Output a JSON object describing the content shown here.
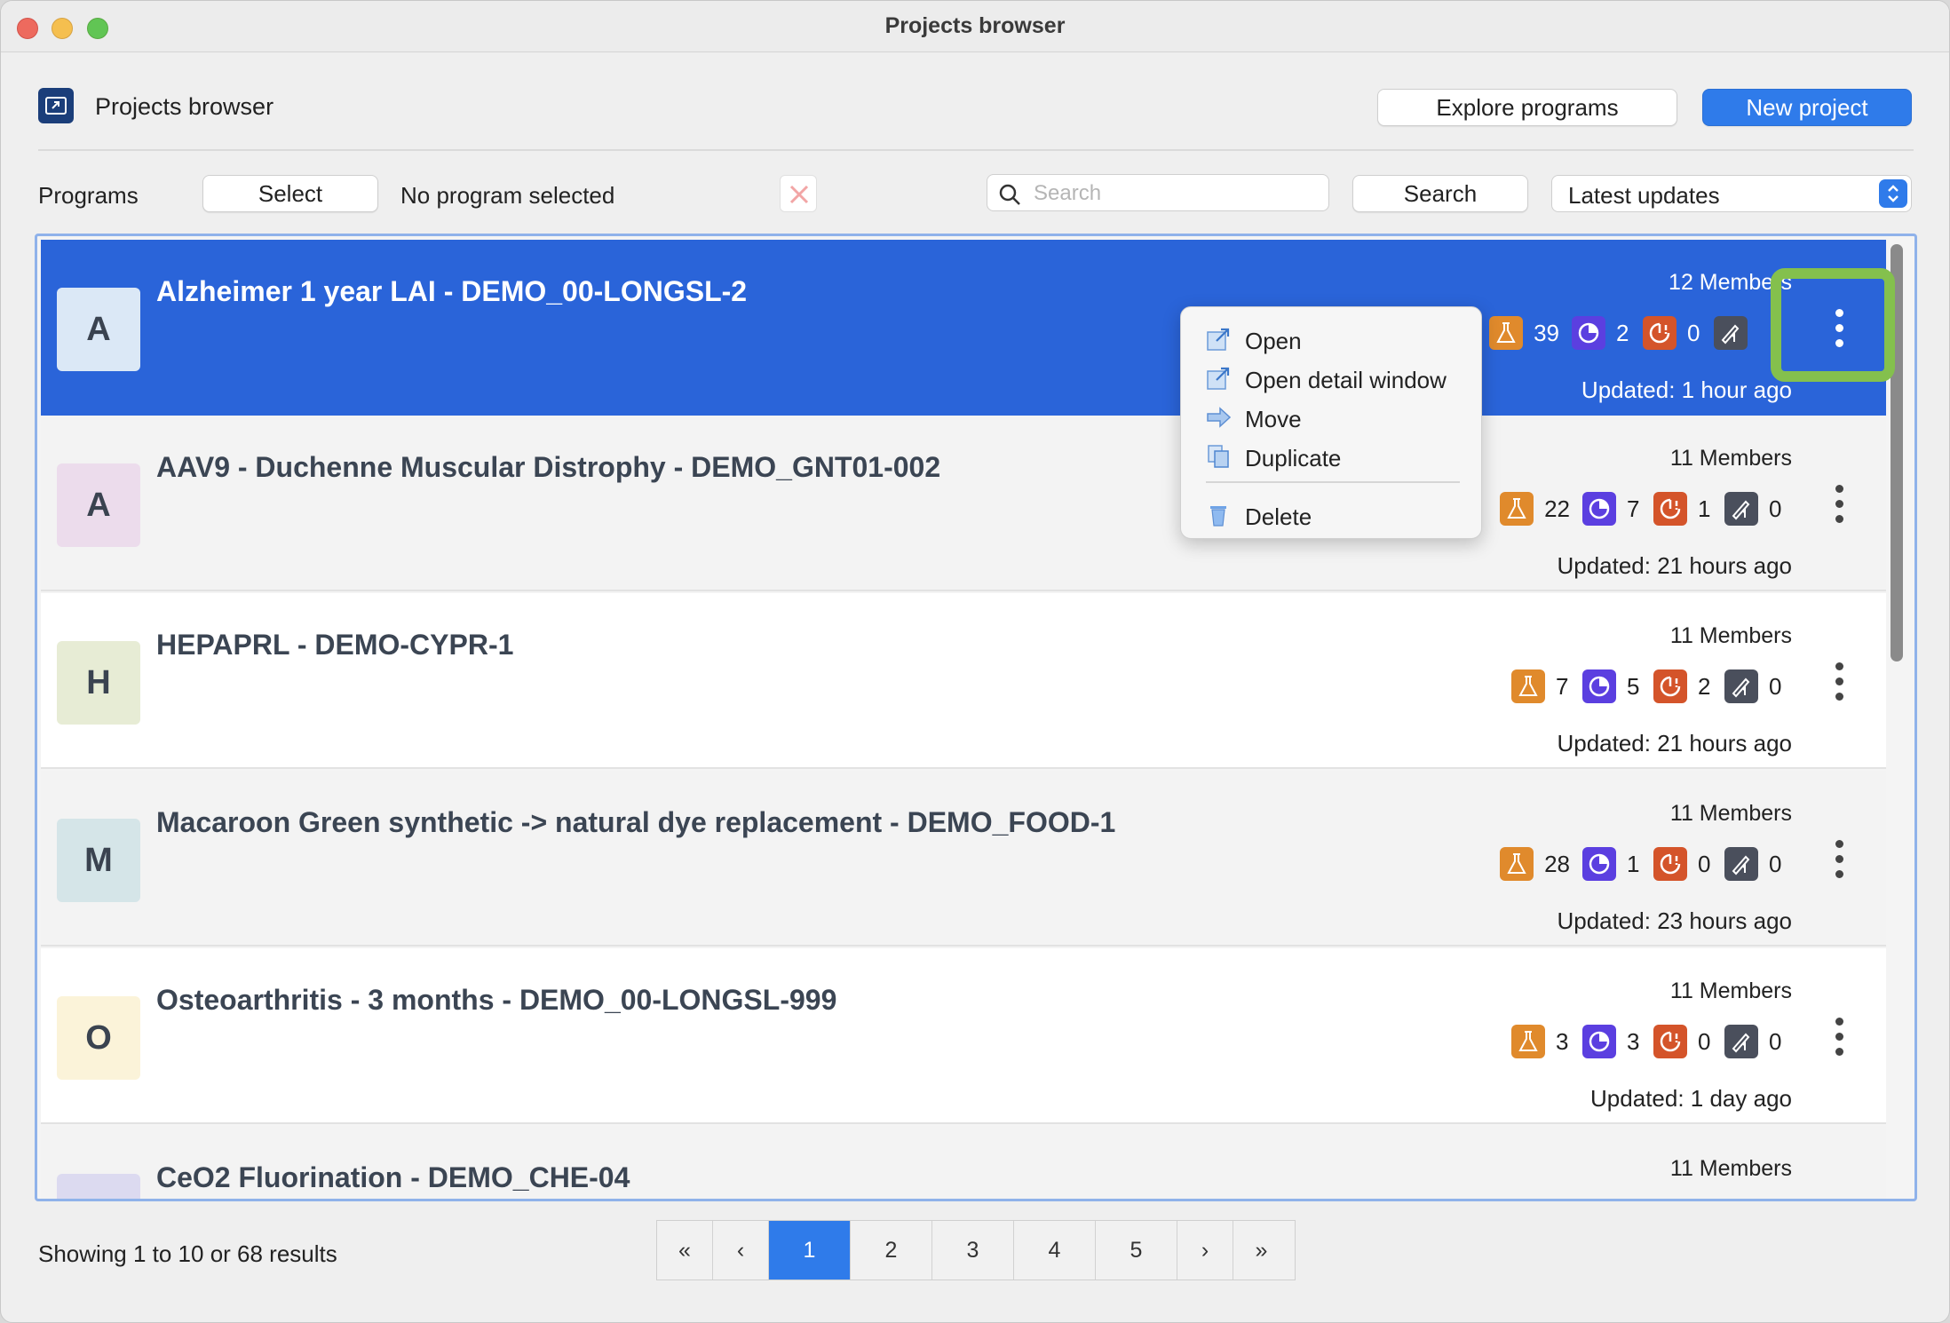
{
  "window": {
    "title": "Projects browser"
  },
  "header": {
    "title": "Projects browser",
    "explore_label": "Explore programs",
    "new_project_label": "New project"
  },
  "filters": {
    "programs_label": "Programs",
    "select_label": "Select",
    "program_status": "No program selected",
    "search_placeholder": "Search",
    "search_value": "",
    "search_button": "Search",
    "sort_selected": "Latest updates"
  },
  "projects": [
    {
      "avatar": "A",
      "avatar_color": "#dbe8f6",
      "title": "Alzheimer 1 year LAI - DEMO_00-LONGSL-2",
      "members": "12 Members",
      "experiments": "39",
      "in_progress": "2",
      "overdue": "0",
      "signatures": "",
      "updated": "Updated: 1 hour ago",
      "selected": true
    },
    {
      "avatar": "A",
      "avatar_color": "#ecdcec",
      "title": "AAV9 - Duchenne Muscular Distrophy - DEMO_GNT01-002",
      "members": "11 Members",
      "experiments": "22",
      "in_progress": "7",
      "overdue": "1",
      "signatures": "0",
      "updated": "Updated: 21 hours ago"
    },
    {
      "avatar": "H",
      "avatar_color": "#e7ecd5",
      "title": "HEPAPRL - DEMO-CYPR-1",
      "members": "11 Members",
      "experiments": "7",
      "in_progress": "5",
      "overdue": "2",
      "signatures": "0",
      "updated": "Updated: 21 hours ago"
    },
    {
      "avatar": "M",
      "avatar_color": "#d5e5e8",
      "title": "Macaroon Green synthetic -> natural dye replacement - DEMO_FOOD-1",
      "members": "11 Members",
      "experiments": "28",
      "in_progress": "1",
      "overdue": "0",
      "signatures": "0",
      "updated": "Updated: 23 hours ago"
    },
    {
      "avatar": "O",
      "avatar_color": "#fbf3d9",
      "title": "Osteoarthritis - 3 months - DEMO_00-LONGSL-999",
      "members": "11 Members",
      "experiments": "3",
      "in_progress": "3",
      "overdue": "0",
      "signatures": "0",
      "updated": "Updated: 1 day ago"
    },
    {
      "avatar": "",
      "avatar_color": "#dcdaf0",
      "title": "CeO2 Fluorination - DEMO_CHE-04",
      "members": "11 Members"
    }
  ],
  "context_menu": {
    "open": "Open",
    "open_detail": "Open detail window",
    "move": "Move",
    "duplicate": "Duplicate",
    "delete": "Delete"
  },
  "footer": {
    "showing": "Showing 1 to 10 or 68 results",
    "pages": [
      "1",
      "2",
      "3",
      "4",
      "5"
    ],
    "first": "«",
    "prev": "‹",
    "next": "›",
    "last": "»"
  },
  "icons": {
    "experiments": "flask-icon",
    "in_progress": "pie-progress-icon",
    "overdue": "overdue-clock-icon",
    "signatures": "signature-pen-icon"
  },
  "colors": {
    "accent": "#2f7bea",
    "selected_row": "#2a64d9",
    "experiments": "#e08a2c",
    "in_progress": "#5b3fe0",
    "overdue": "#d4542a",
    "signatures": "#4a4f5c",
    "highlight": "#84c04d"
  }
}
